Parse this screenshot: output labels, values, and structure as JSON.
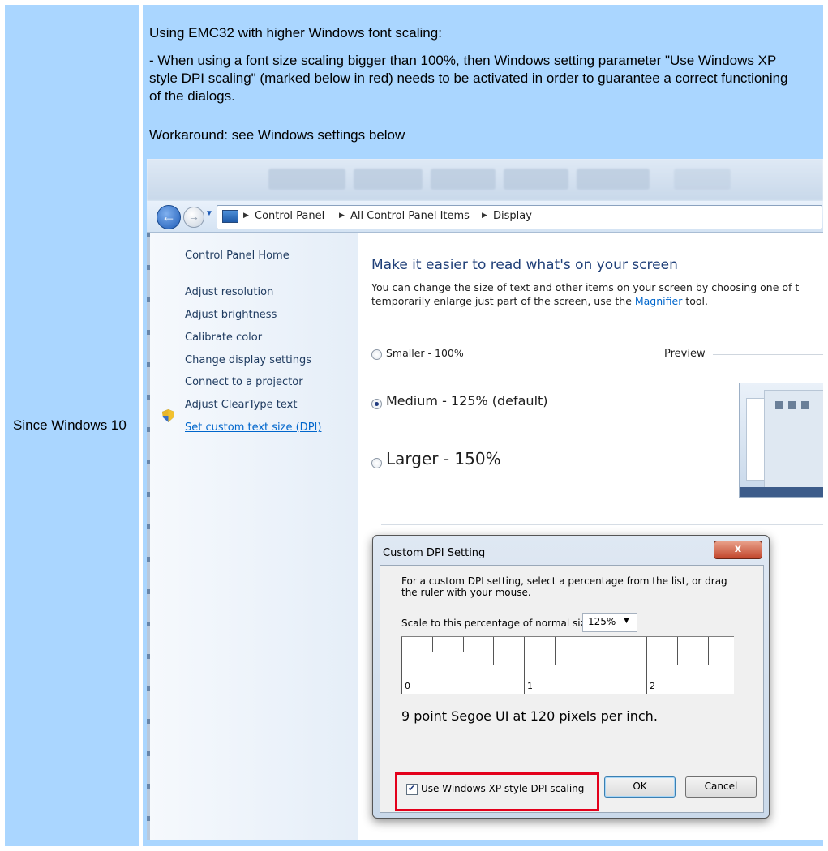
{
  "table": {
    "row_label": "Since Windows 10",
    "note_heading": "Using EMC32 with higher Windows font scaling:",
    "note_body": "- When using a font size scaling bigger than 100%, then Windows setting parameter \"Use Windows XP style DPI scaling\" (marked below in red) needs to be activated in order to guarantee a correct functioning of the dialogs.",
    "note_workaround": "Workaround: see Windows settings below"
  },
  "explorer": {
    "breadcrumbs": [
      "Control Panel",
      "All Control Panel Items",
      "Display"
    ]
  },
  "sidebar": {
    "items": [
      {
        "label": "Control Panel Home"
      },
      {
        "label": "Adjust resolution"
      },
      {
        "label": "Adjust brightness"
      },
      {
        "label": "Calibrate color",
        "icon": "shield-icon"
      },
      {
        "label": "Change display settings"
      },
      {
        "label": "Connect to a projector"
      },
      {
        "label": "Adjust ClearType text"
      },
      {
        "label": "Set custom text size (DPI)"
      }
    ]
  },
  "content": {
    "title": "Make it easier to read what's on your screen",
    "desc_line1": "You can change the size of text and other items on your screen by choosing one of t",
    "desc_line2_pre": "temporarily enlarge just part of the screen, use the ",
    "magnifier_link": "Magnifier",
    "desc_line2_post": " tool.",
    "options": [
      {
        "label": "Smaller - 100%",
        "checked": false
      },
      {
        "label": "Medium - 125% (default)",
        "checked": true
      },
      {
        "label": "Larger - 150%",
        "checked": false
      }
    ],
    "preview_label": "Preview"
  },
  "dialog": {
    "title": "Custom DPI Setting",
    "close_label": "x",
    "description": "For a custom DPI setting, select a percentage from the list, or drag the ruler with your mouse.",
    "scale_label": "Scale to this percentage of normal size:",
    "scale_value": "125%",
    "ruler_numbers": [
      "0",
      "1",
      "2"
    ],
    "font_info": "9 point Segoe UI at 120 pixels per inch.",
    "xp_checkbox_label": "Use Windows XP style DPI scaling",
    "xp_checked": true,
    "ok_label": "OK",
    "cancel_label": "Cancel"
  },
  "colors": {
    "table_cell": "#aad6ff",
    "highlight_red": "#e3001b",
    "link_blue": "#0066cc"
  }
}
